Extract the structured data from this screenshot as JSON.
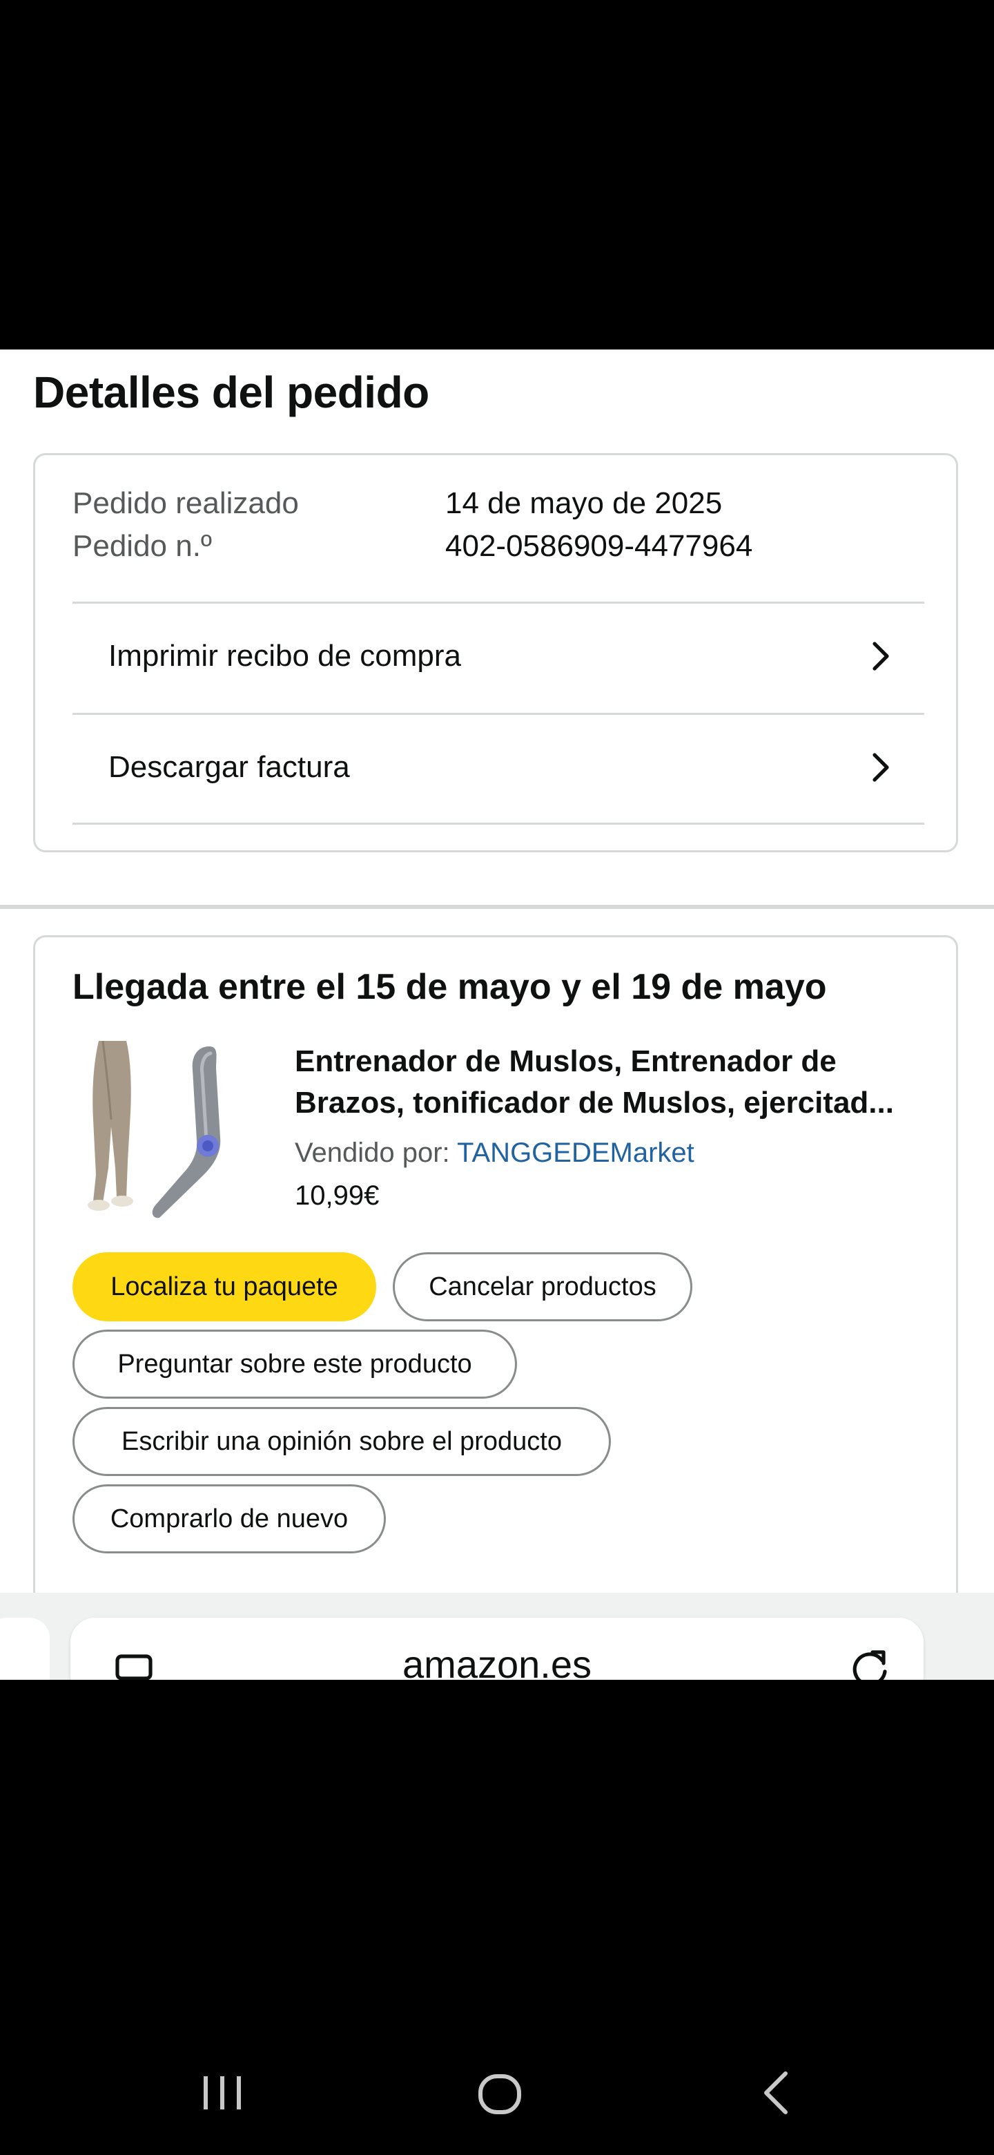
{
  "page": {
    "title": "Detalles del pedido"
  },
  "summary": {
    "order_placed_label": "Pedido realizado",
    "order_placed_value": "14 de mayo de 2025",
    "order_number_label": "Pedido n.º",
    "order_number_value": "402-0586909-4477964",
    "links": [
      {
        "label": "Imprimir recibo de compra",
        "icon": "chevron-right-icon"
      },
      {
        "label": "Descargar factura",
        "icon": "chevron-right-icon"
      }
    ]
  },
  "delivery": {
    "title": "Llegada entre el 15 de mayo y el 19 de mayo",
    "product": {
      "title": "Entrenador de Muslos, Entrenador de Brazos, tonificador de Muslos, ejercitad...",
      "sold_by_label": "Vendido por: ",
      "seller": "TANGGEDEMarket",
      "price": "10,99€"
    },
    "actions": {
      "track": "Localiza tu paquete",
      "cancel": "Cancelar productos",
      "ask": "Preguntar sobre este producto",
      "review": "Escribir una opinión sobre el producto",
      "buy_again": "Comprarlo de nuevo"
    }
  },
  "browser": {
    "url": "amazon.es",
    "left_icon": "tabs-icon",
    "right_icon": "reload-icon"
  },
  "system_nav": {
    "icons": [
      "recent-apps-icon",
      "home-icon",
      "back-icon"
    ]
  },
  "colors": {
    "primary_button": "#ffd814",
    "link": "#2162a1",
    "border": "#d5d9d9",
    "secondary_text": "#565959"
  }
}
